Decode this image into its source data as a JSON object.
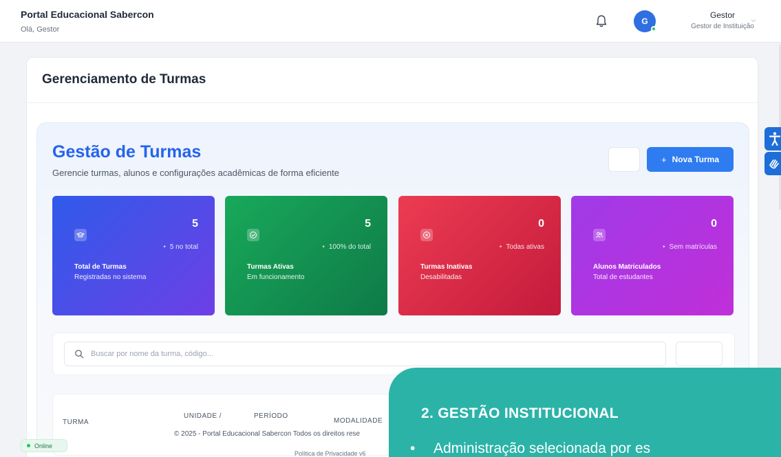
{
  "header": {
    "portal_name": "Portal Educacional Sabercon",
    "greeting": "Olá, Gestor",
    "avatar_initial": "G",
    "user_name": "Gestor",
    "user_role": "Gestor de Instituição"
  },
  "page": {
    "title": "Gerenciamento de Turmas",
    "section_title": "Gestão de Turmas",
    "section_subtitle": "Gerencie turmas, alunos e configurações acadêmicas de forma eficiente",
    "new_button_icon": "+",
    "new_button_label": "Nova Turma"
  },
  "stats": [
    {
      "value": "5",
      "meta": "5 no total",
      "label": "Total de Turmas",
      "desc": "Registradas no sistema",
      "icon": "graduation-cap-icon"
    },
    {
      "value": "5",
      "meta": "100% do total",
      "label": "Turmas Ativas",
      "desc": "Em funcionamento",
      "icon": "check-circle-icon"
    },
    {
      "value": "0",
      "meta": "Todas ativas",
      "label": "Turmas Inativas",
      "desc": "Desabilitadas",
      "icon": "x-circle-icon"
    },
    {
      "value": "0",
      "meta": "Sem matrículas",
      "label": "Alunos Matriculados",
      "desc": "Total de estudantes",
      "icon": "users-icon"
    }
  ],
  "search": {
    "placeholder": "Buscar por nome da turma, código..."
  },
  "table": {
    "headers": [
      "TURMA",
      "UNIDADE /",
      "PERÍODO",
      "MODALIDADE"
    ]
  },
  "footer": {
    "copyright": "© 2025 - Portal Educacional Sabercon Todos os direitos rese",
    "links": "Política de Privacidade   v6",
    "status": "Online"
  },
  "slide": {
    "title": "2.   GESTÃO INSTITUCIONAL",
    "bullet": "Administração selecionada por es"
  },
  "colors": {
    "accent": "#2563eb",
    "button": "#2f7cf0",
    "card_blue": "#2f5bea",
    "card_green": "#18a95a",
    "card_red": "#ec3c52",
    "card_purple": "#a03ae8",
    "slide_teal": "#2bb3a8"
  }
}
